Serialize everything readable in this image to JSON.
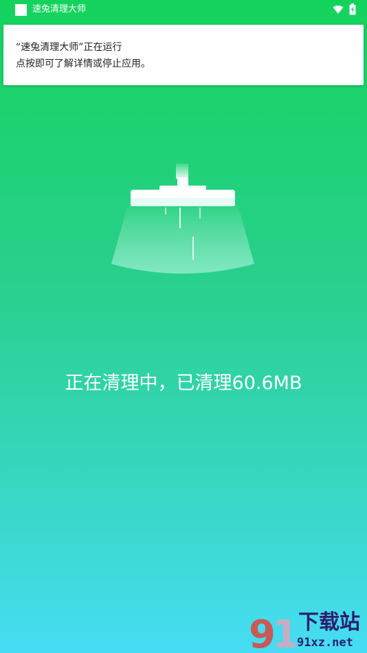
{
  "status_bar": {
    "app_title": "速兔清理大师",
    "icons": [
      "app-square-icon",
      "wifi-icon",
      "battery-charging-icon"
    ]
  },
  "notification": {
    "line1": "“速兔清理大师”正在运行",
    "line2": "点按即可了解详情或停止应用。"
  },
  "main": {
    "illustration": "broom-icon",
    "status_text": "正在清理中，已清理60.6MB"
  },
  "watermark": {
    "logo_text": "91",
    "site_name": "下载站",
    "domain": "91xz.net"
  },
  "colors": {
    "gradient_top": "#14d35c",
    "gradient_bottom": "#46ddf4",
    "text_on_bg": "#ffffff",
    "notification_bg": "#ffffff",
    "watermark_ink": "#2b1f6e",
    "watermark_accent": "#e0443b"
  }
}
